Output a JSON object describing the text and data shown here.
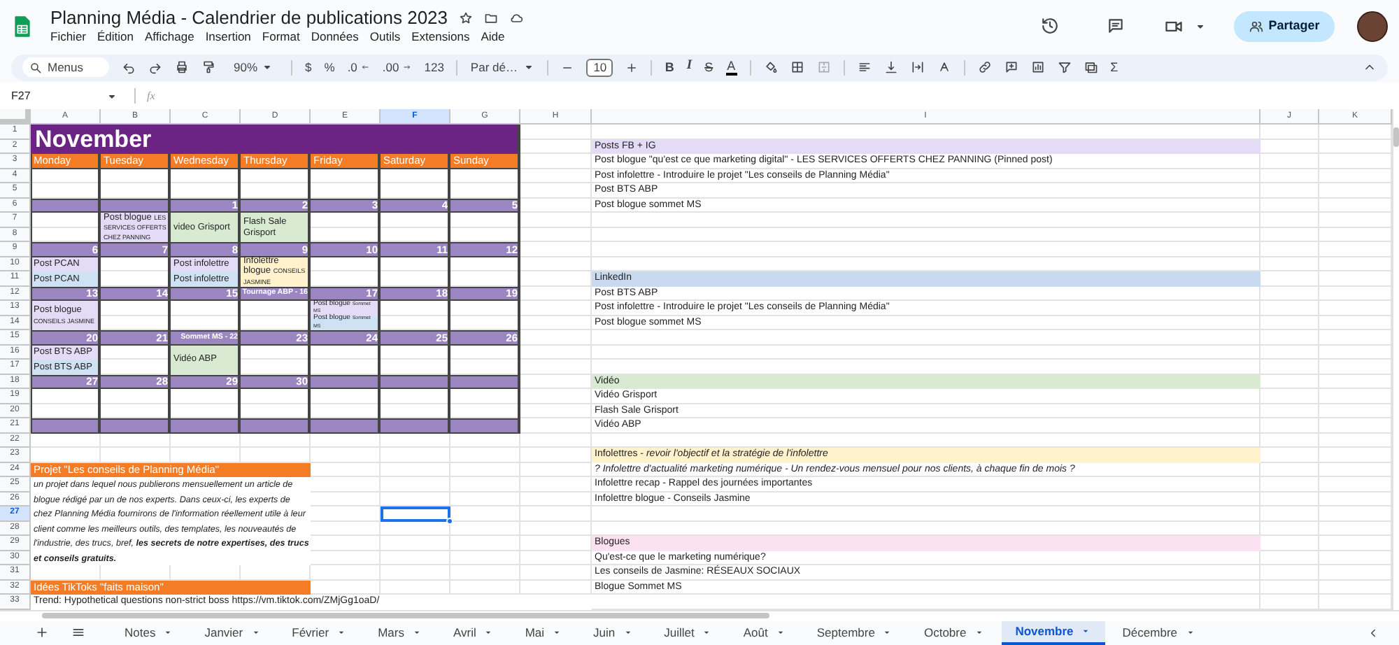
{
  "app": {
    "title": "Planning Média - Calendrier de publications 2023",
    "menus": [
      "Fichier",
      "Édition",
      "Affichage",
      "Insertion",
      "Format",
      "Données",
      "Outils",
      "Extensions",
      "Aide"
    ],
    "share": "Partager"
  },
  "toolbar": {
    "search": "Menus",
    "zoom": "90%",
    "currency": "$",
    "percent": "%",
    "decrease_decimals": ".0",
    "increase_decimals": ".00",
    "number_format": "123",
    "font": "Par dé…",
    "font_size": "10",
    "bold": "B",
    "italic": "I",
    "strikethrough": "S",
    "text_color": "A",
    "functions": "Σ"
  },
  "formula_bar": {
    "cell": "F27",
    "fx": "fx"
  },
  "columns": [
    {
      "label": "A",
      "selected": false
    },
    {
      "label": "B",
      "selected": false
    },
    {
      "label": "C",
      "selected": false
    },
    {
      "label": "D",
      "selected": false
    },
    {
      "label": "E",
      "selected": false
    },
    {
      "label": "F",
      "selected": true
    },
    {
      "label": "G",
      "selected": false
    },
    {
      "label": "H",
      "selected": false
    },
    {
      "label": "I",
      "selected": false
    },
    {
      "label": "J",
      "selected": false
    },
    {
      "label": "K",
      "selected": false
    }
  ],
  "rows": [
    {
      "label": "1",
      "selected": false
    },
    {
      "label": "2",
      "selected": false
    },
    {
      "label": "3",
      "selected": false
    },
    {
      "label": "4",
      "selected": false
    },
    {
      "label": "5",
      "selected": false
    },
    {
      "label": "6",
      "selected": false
    },
    {
      "label": "7",
      "selected": false
    },
    {
      "label": "8",
      "selected": false
    },
    {
      "label": "9",
      "selected": false
    },
    {
      "label": "10",
      "selected": false
    },
    {
      "label": "11",
      "selected": false
    },
    {
      "label": "12",
      "selected": false
    },
    {
      "label": "13",
      "selected": false
    },
    {
      "label": "14",
      "selected": false
    },
    {
      "label": "15",
      "selected": false
    },
    {
      "label": "16",
      "selected": false
    },
    {
      "label": "17",
      "selected": false
    },
    {
      "label": "18",
      "selected": false
    },
    {
      "label": "19",
      "selected": false
    },
    {
      "label": "20",
      "selected": false
    },
    {
      "label": "21",
      "selected": false
    },
    {
      "label": "22",
      "selected": false
    },
    {
      "label": "23",
      "selected": false
    },
    {
      "label": "24",
      "selected": false
    },
    {
      "label": "25",
      "selected": false
    },
    {
      "label": "26",
      "selected": false
    },
    {
      "label": "27",
      "selected": true
    },
    {
      "label": "28",
      "selected": false
    },
    {
      "label": "29",
      "selected": false
    },
    {
      "label": "30",
      "selected": false
    },
    {
      "label": "31",
      "selected": false
    },
    {
      "label": "32",
      "selected": false
    },
    {
      "label": "33",
      "selected": false
    }
  ],
  "calendar": {
    "month": "November",
    "days": [
      "Monday",
      "Tuesday",
      "Wednesday",
      "Thursday",
      "Friday",
      "Saturday",
      "Sunday"
    ],
    "slots": [
      {
        "kind": "events"
      },
      {
        "kind": "dates",
        "dates": [
          "1",
          "2",
          "3",
          "4",
          "5"
        ]
      },
      {
        "kind": "events",
        "cells": [
          [],
          [
            {
              "text": "Post blogue",
              "note": "LES SERVICES OFFERTS CHEZ PANNING",
              "kind": "full",
              "color": "#e4dcf7"
            }
          ],
          [
            {
              "text": "video Grisport",
              "kind": "full",
              "color": "#d9ead3"
            }
          ],
          [
            {
              "text": "Flash Sale Grisport",
              "kind": "full",
              "color": "#d9ead3"
            }
          ]
        ]
      },
      {
        "kind": "dates",
        "dates": [
          "6",
          "7",
          "8",
          "9",
          "10",
          "11",
          "12"
        ]
      },
      {
        "kind": "events",
        "cells": [
          [
            {
              "text": "Post PCAN",
              "kind": "upper",
              "color": "#e4dcf7"
            },
            {
              "text": "Post PCAN",
              "kind": "lower",
              "color": "#cfe2f3"
            }
          ],
          [],
          [
            {
              "text": "Post infolettre",
              "kind": "upper",
              "color": "#e4dcf7"
            },
            {
              "text": "Post infolettre",
              "kind": "lower",
              "color": "#cfe2f3"
            }
          ],
          [
            {
              "text": "Infolettre blogue",
              "note": "CONSEILS JASMINE",
              "kind": "full",
              "color": "#fff2cc"
            }
          ]
        ]
      },
      {
        "kind": "dates",
        "dates": [
          "13",
          "14",
          "15",
          "Tournage ABP - 16",
          "17",
          "18",
          "19"
        ]
      },
      {
        "kind": "events",
        "cells": [
          [
            {
              "text": "Post blogue",
              "note": "CONSEILS JASMINE",
              "kind": "full",
              "color": "#e4dcf7"
            }
          ],
          [],
          [],
          [],
          [
            {
              "text": "Post blogue",
              "note": "Sommet MS",
              "kind": "upper",
              "color": "#e4dcf7"
            },
            {
              "text": "Post blogue",
              "note": "Sommet MS",
              "kind": "lower",
              "color": "#cfe2f3"
            }
          ]
        ]
      },
      {
        "kind": "dates",
        "dates": [
          "20",
          "21",
          "Sommet MS - 22",
          "23",
          "24",
          "25",
          "26"
        ]
      },
      {
        "kind": "events",
        "cells": [
          [
            {
              "text": "Post BTS ABP",
              "kind": "upper",
              "color": "#e4dcf7"
            },
            {
              "text": "Post BTS ABP",
              "kind": "lower",
              "color": "#cfe2f3"
            }
          ],
          [],
          [
            {
              "text": "Vidéo ABP",
              "kind": "full",
              "color": "#d9ead3"
            }
          ]
        ]
      },
      {
        "kind": "dates",
        "dates": [
          "27",
          "28",
          "29",
          "30"
        ]
      },
      {
        "kind": "events"
      },
      {
        "kind": "dates"
      }
    ]
  },
  "notes": [
    {
      "kind": "heading",
      "text": "Projet \"Les conseils de Planning Média\""
    },
    {
      "kind": "paragraph",
      "text": "un projet dans lequel nous publierons mensuellement un article de blogue rédigé par un de nos experts. Dans ceux-ci, les experts de chez Planning Média fournirons de l'information réellement utile à leur client comme les meilleurs outils, des templates, les nouveautés de l'industrie, des trucs, bref, **les secrets de notre expertises, des trucs et conseils gratuits.**"
    },
    {
      "kind": "heading",
      "text": "Idées TikToks \"faits maison\""
    },
    {
      "kind": "text",
      "text": "Trend: Hypothetical questions non-strict boss https://vm.tiktok.com/ZMjGg1oaD/"
    }
  ],
  "sections": [
    {
      "title": "Posts FB + IG",
      "color": "#e4dcf7",
      "items": [
        {
          "text": "Post blogue \"qu'est ce que marketing digital\" - LES SERVICES OFFERTS CHEZ PANNING (Pinned post)",
          "italic": false
        },
        {
          "text": "Post infolettre - Introduire le projet \"Les conseils de Planning Média\"",
          "italic": false
        },
        {
          "text": "Post BTS ABP",
          "italic": false
        },
        {
          "text": "Post blogue sommet MS",
          "italic": false
        }
      ]
    },
    {
      "title": "LinkedIn",
      "color": "#c9daf0",
      "items": [
        {
          "text": "Post BTS ABP",
          "italic": false
        },
        {
          "text": "Post infolettre - Introduire le projet \"Les conseils de Planning Média\"",
          "italic": false
        },
        {
          "text": "Post blogue sommet MS",
          "italic": false
        }
      ]
    },
    {
      "title": "Vidéo",
      "color": "#d9ead3",
      "items": [
        {
          "text": "Vidéo Grisport",
          "italic": false
        },
        {
          "text": "Flash Sale Grisport",
          "italic": false
        },
        {
          "text": "Vidéo ABP",
          "italic": false
        }
      ]
    },
    {
      "title": "Infolettres - *revoir l'objectif et la stratégie de l'infolettre*",
      "color": "#fff2cc",
      "items": [
        {
          "text": "? Infolettre d'actualité marketing numérique - Un rendez-vous mensuel pour nos clients, à chaque fin de mois ?",
          "italic": true
        },
        {
          "text": "Infolettre recap - Rappel des journées importantes",
          "italic": false
        },
        {
          "text": "Infolettre blogue - Conseils Jasmine",
          "italic": false
        }
      ]
    },
    {
      "title": "Blogues",
      "color": "#fce1f3",
      "items": [
        {
          "text": "Qu'est-ce que le marketing numérique?",
          "italic": false
        },
        {
          "text": "Les conseils de Jasmine: RÉSEAUX SOCIAUX",
          "italic": false
        },
        {
          "text": "Blogue Sommet MS",
          "italic": false
        }
      ]
    }
  ],
  "sheet_tabs": [
    {
      "label": "Notes",
      "selected": false
    },
    {
      "label": "Janvier",
      "selected": false
    },
    {
      "label": "Février",
      "selected": false
    },
    {
      "label": "Mars",
      "selected": false
    },
    {
      "label": "Avril",
      "selected": false
    },
    {
      "label": "Mai",
      "selected": false
    },
    {
      "label": "Juin",
      "selected": false
    },
    {
      "label": "Juillet",
      "selected": false
    },
    {
      "label": "Août",
      "selected": false
    },
    {
      "label": "Septembre",
      "selected": false
    },
    {
      "label": "Octobre",
      "selected": false
    },
    {
      "label": "Novembre",
      "selected": true
    },
    {
      "label": "Décembre",
      "selected": false
    }
  ]
}
